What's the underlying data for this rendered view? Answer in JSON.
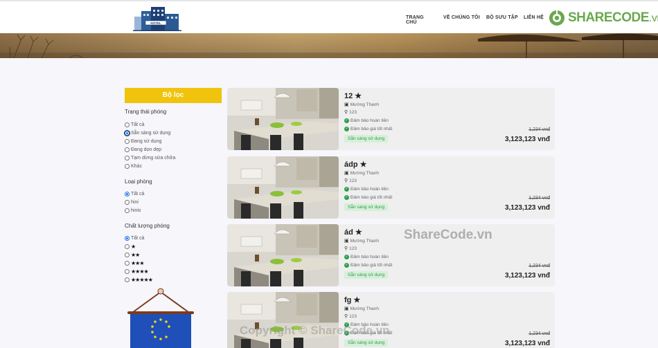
{
  "header": {
    "nav": [
      "TRANG CHỦ",
      "VỀ CHÚNG TÔI",
      "BỘ SƯU TẬP",
      "LIÊN HỆ"
    ],
    "brand_main": "SHARECODE",
    "brand_suffix": ".vn",
    "logo_text": "HOTEL"
  },
  "sidebar": {
    "filter_title": "Bộ lọc",
    "status_title": "Trạng thái phòng",
    "status_options": [
      "Tất cả",
      "Sẵn sàng sử dụng",
      "Đang sử dụng",
      "Đang dọn dẹp",
      "Tạm dừng sửa chữa",
      "Khác"
    ],
    "status_selected": "Sẵn sàng sử dụng",
    "type_title": "Loại phòng",
    "type_options": [
      "Tất cả",
      "hini",
      "hinis"
    ],
    "type_selected": "Tất cả",
    "quality_title": "Chất lượng phòng",
    "quality_options": [
      "Tất cả",
      "★",
      "★★",
      "★★★",
      "★★★★",
      "★★★★★"
    ],
    "quality_selected": "Tất cả"
  },
  "rooms": [
    {
      "name": "12",
      "hotel": "Mường Thanh",
      "address": "123",
      "perk1": "Đảm bảo hoàn tiền",
      "perk2": "Đảm bảo giá tốt nhất",
      "status": "Sẵn sàng sử dụng",
      "old_price": "1,234 vnđ",
      "price": "3,123,123 vnđ"
    },
    {
      "name": "ádp",
      "hotel": "Mường Thanh",
      "address": "123",
      "perk1": "Đảm bảo hoàn tiền",
      "perk2": "Đảm bảo giá tốt nhất",
      "status": "Sẵn sàng sử dụng",
      "old_price": "1,234 vnđ",
      "price": "3,123,123 vnđ"
    },
    {
      "name": "ád",
      "hotel": "Mường Thanh",
      "address": "123",
      "perk1": "Đảm bảo hoàn tiền",
      "perk2": "Đảm bảo giá tốt nhất",
      "status": "Sẵn sàng sử dụng",
      "old_price": "1,234 vnđ",
      "price": "3,123,123 vnđ"
    },
    {
      "name": "fg",
      "hotel": "Mường Thanh",
      "address": "123",
      "perk1": "Đảm bảo hoàn tiền",
      "perk2": "Đảm bảo giá tốt nhất",
      "status": "Sẵn sàng sử dụng",
      "old_price": "1,234 vnđ",
      "price": "3,123,123 vnđ"
    }
  ],
  "watermarks": [
    "ShareCode.vn",
    "Copyright © ShareCode.vn"
  ],
  "colors": {
    "accent": "#f0c30d",
    "success": "#2e9e4a",
    "brand": "#6aa84f"
  }
}
